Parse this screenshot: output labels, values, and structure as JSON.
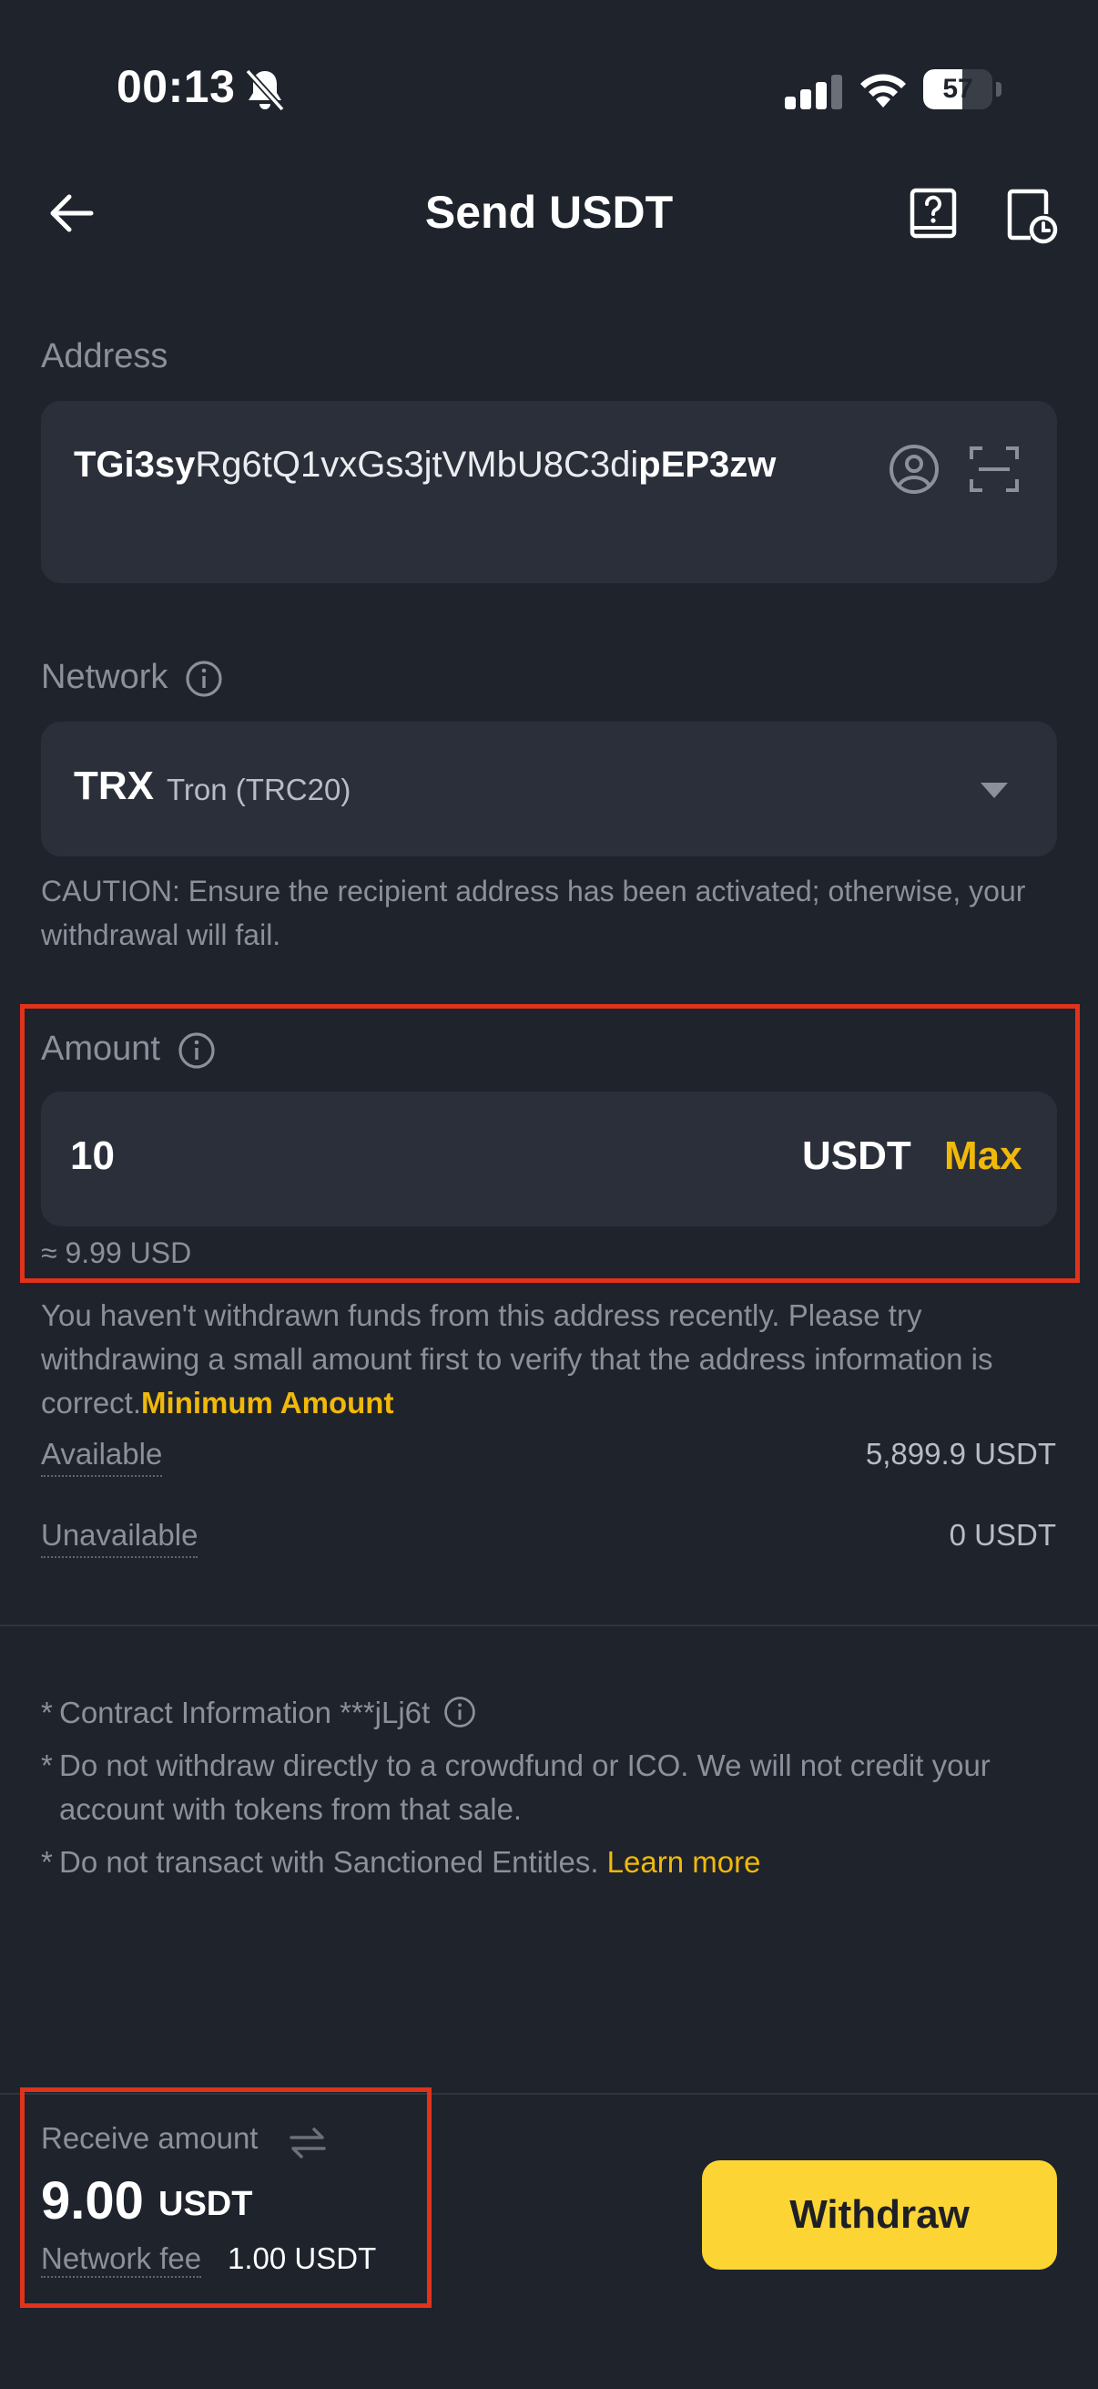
{
  "status_bar": {
    "time": "00:13",
    "battery": "57",
    "battery_level": 0.57
  },
  "header": {
    "title": "Send USDT"
  },
  "address": {
    "label": "Address",
    "value_prefix": "TGi3sy",
    "value_middle": "Rg6tQ1vxGs3jtVMbU8C3di",
    "value_suffix": "pEP3zw"
  },
  "network": {
    "label": "Network",
    "code": "TRX",
    "name": "Tron (TRC20)",
    "caution": "CAUTION: Ensure the recipient address has been activated; otherwise, your withdrawal will fail."
  },
  "amount": {
    "label": "Amount",
    "value": "10",
    "unit": "USDT",
    "max_label": "Max",
    "usd_equivalent": "≈ 9.99 USD"
  },
  "notice": {
    "text": "You haven't withdrawn funds from this address recently. Please try withdrawing a small amount first to verify that the address information is correct.",
    "link": "Minimum Amount"
  },
  "balances": {
    "available_label": "Available",
    "available_value": "5,899.9 USDT",
    "unavailable_label": "Unavailable",
    "unavailable_value": "0 USDT"
  },
  "notes": {
    "star": "*",
    "contract": "Contract Information ***jLj6t",
    "crowdfund": "Do not withdraw directly to a crowdfund or ICO. We will not credit your account with tokens from that sale.",
    "sanctioned": "Do not transact with Sanctioned Entitles.",
    "learn_more": "Learn more"
  },
  "footer": {
    "receive_label": "Receive amount",
    "receive_value": "9.00",
    "receive_unit": "USDT",
    "fee_label": "Network fee",
    "fee_value": "1.00 USDT",
    "withdraw_label": "Withdraw"
  },
  "colors": {
    "background": "#1f232c",
    "field": "#2b2f3a",
    "accent": "#f0b90b",
    "button": "#fcd535",
    "highlight": "#e1321c"
  }
}
